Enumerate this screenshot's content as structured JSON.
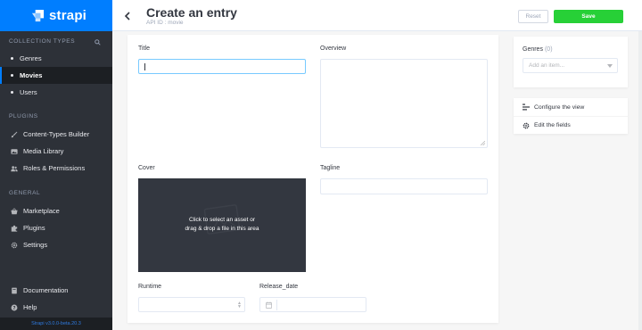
{
  "brand": {
    "name": "strapi",
    "color": "#007eff"
  },
  "sidebar": {
    "collection_types_title": "COLLECTION TYPES",
    "collection_items": [
      {
        "label": "Genres",
        "active": false
      },
      {
        "label": "Movies",
        "active": true
      },
      {
        "label": "Users",
        "active": false
      }
    ],
    "plugins_title": "PLUGINS",
    "plugin_items": [
      {
        "label": "Content-Types Builder",
        "icon": "paint-brush-icon"
      },
      {
        "label": "Media Library",
        "icon": "image-icon"
      },
      {
        "label": "Roles & Permissions",
        "icon": "users-icon"
      }
    ],
    "general_title": "GENERAL",
    "general_items": [
      {
        "label": "Marketplace",
        "icon": "shopping-basket-icon"
      },
      {
        "label": "Plugins",
        "icon": "puzzle-icon"
      },
      {
        "label": "Settings",
        "icon": "gear-icon"
      }
    ],
    "footer_items": [
      {
        "label": "Documentation",
        "icon": "book-icon"
      },
      {
        "label": "Help",
        "icon": "question-icon"
      }
    ],
    "version": "Strapi v3.0.0-beta.20.3"
  },
  "header": {
    "title": "Create an entry",
    "subtitle": "API ID : movie",
    "reset_label": "Reset",
    "save_label": "Save",
    "save_color": "#27d037"
  },
  "form": {
    "title_label": "Title",
    "title_value": "",
    "overview_label": "Overview",
    "overview_value": "",
    "cover_label": "Cover",
    "cover_text_line1": "Click to select an asset or",
    "cover_text_line2": "drag & drop a file in this area",
    "tagline_label": "Tagline",
    "tagline_value": "",
    "runtime_label": "Runtime",
    "runtime_value": "",
    "release_date_label": "Release_date",
    "release_date_value": ""
  },
  "side_panel": {
    "genres_label": "Genres",
    "genres_count": "(0)",
    "genres_placeholder": "Add an item...",
    "configure_view_label": "Configure the view",
    "edit_fields_label": "Edit the fields"
  }
}
